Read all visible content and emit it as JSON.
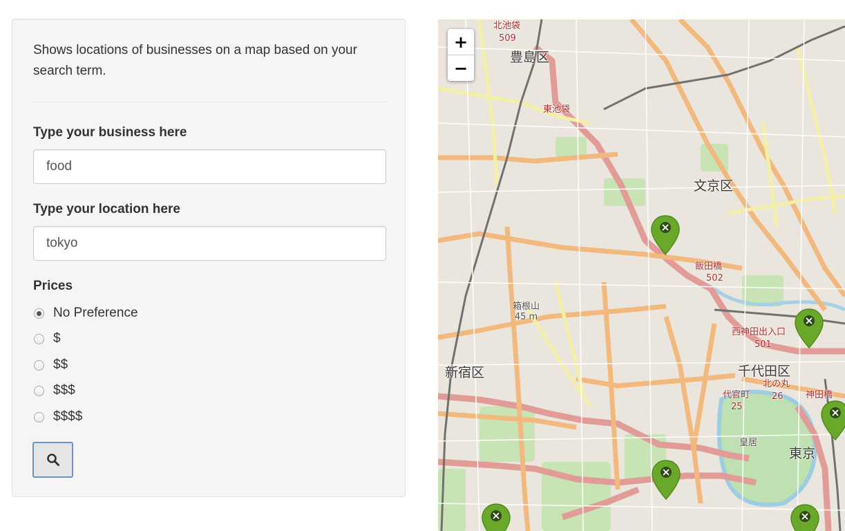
{
  "description": "Shows locations of businesses on a map based on your search term.",
  "business": {
    "label": "Type your business here",
    "value": "food"
  },
  "location": {
    "label": "Type your location here",
    "value": "tokyo"
  },
  "prices": {
    "label": "Prices",
    "selected": "No Preference",
    "options": [
      "No Preference",
      "$",
      "$$",
      "$$$",
      "$$$$"
    ]
  },
  "search_button": {
    "icon": "search-icon"
  },
  "map": {
    "zoom_in": "+",
    "zoom_out": "−",
    "districts": [
      "豊島区",
      "文京区",
      "新宿区",
      "千代田区",
      "東京"
    ],
    "stations": [
      "北池袋",
      "509",
      "東池袋",
      "飯田橋",
      "502",
      "西神田出入口",
      "501",
      "代官町",
      "25",
      "北の丸",
      "26",
      "神田橋",
      "皇居"
    ],
    "landmark": {
      "name": "箱根山",
      "elevation": "45 m"
    },
    "marker_count": 6,
    "marker_color": "#6aa82a"
  }
}
